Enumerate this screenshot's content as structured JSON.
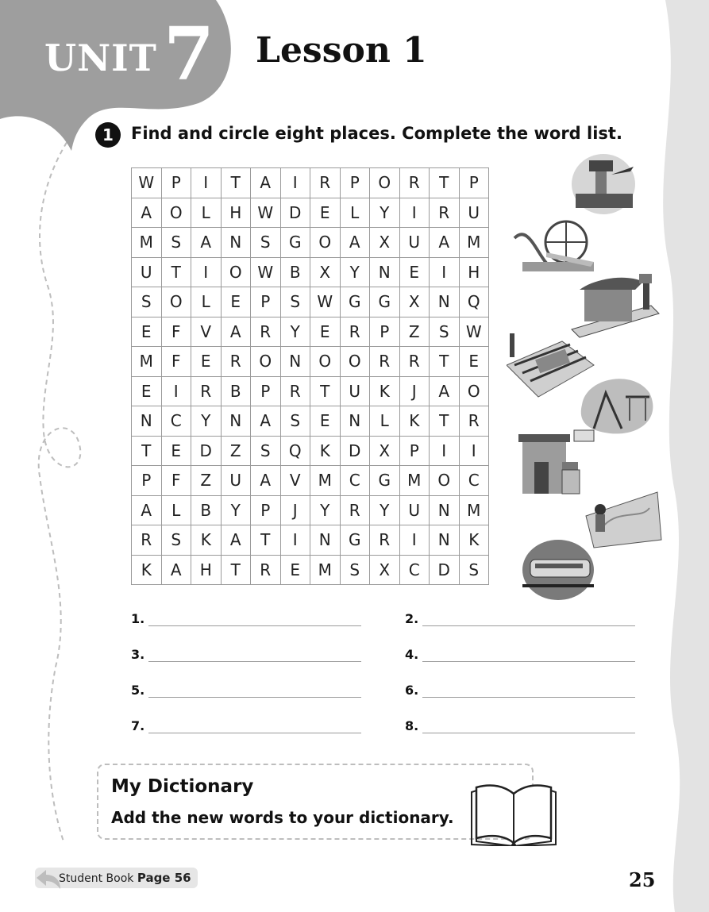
{
  "header": {
    "unit_word": "UNIT",
    "unit_number": "7",
    "lesson_title": "Lesson 1"
  },
  "activity": {
    "number": "1",
    "instructions": "Find and circle eight places. Complete the word list."
  },
  "wordsearch": {
    "rows": [
      [
        "W",
        "P",
        "I",
        "T",
        "A",
        "I",
        "R",
        "P",
        "O",
        "R",
        "T",
        "P"
      ],
      [
        "A",
        "O",
        "L",
        "H",
        "W",
        "D",
        "E",
        "L",
        "Y",
        "I",
        "R",
        "U"
      ],
      [
        "M",
        "S",
        "A",
        "N",
        "S",
        "G",
        "O",
        "A",
        "X",
        "U",
        "A",
        "M"
      ],
      [
        "U",
        "T",
        "I",
        "O",
        "W",
        "B",
        "X",
        "Y",
        "N",
        "E",
        "I",
        "H"
      ],
      [
        "S",
        "O",
        "L",
        "E",
        "P",
        "S",
        "W",
        "G",
        "G",
        "X",
        "N",
        "Q"
      ],
      [
        "E",
        "F",
        "V",
        "A",
        "R",
        "Y",
        "E",
        "R",
        "P",
        "Z",
        "S",
        "W"
      ],
      [
        "M",
        "F",
        "E",
        "R",
        "O",
        "N",
        "O",
        "O",
        "R",
        "R",
        "T",
        "E"
      ],
      [
        "E",
        "I",
        "R",
        "B",
        "P",
        "R",
        "T",
        "U",
        "K",
        "J",
        "A",
        "O"
      ],
      [
        "N",
        "C",
        "Y",
        "N",
        "A",
        "S",
        "E",
        "N",
        "L",
        "K",
        "T",
        "R"
      ],
      [
        "T",
        "E",
        "D",
        "Z",
        "S",
        "Q",
        "K",
        "D",
        "X",
        "P",
        "I",
        "I"
      ],
      [
        "P",
        "F",
        "Z",
        "U",
        "A",
        "V",
        "M",
        "C",
        "G",
        "M",
        "O",
        "C"
      ],
      [
        "A",
        "L",
        "B",
        "Y",
        "P",
        "J",
        "Y",
        "R",
        "Y",
        "U",
        "N",
        "M"
      ],
      [
        "R",
        "S",
        "K",
        "A",
        "T",
        "I",
        "N",
        "G",
        "R",
        "I",
        "N",
        "K"
      ],
      [
        "K",
        "A",
        "H",
        "T",
        "R",
        "E",
        "M",
        "S",
        "X",
        "C",
        "D",
        "S"
      ]
    ]
  },
  "pictures": [
    {
      "icon": "airport-icon"
    },
    {
      "icon": "amusement-park-icon"
    },
    {
      "icon": "bus-stop-icon"
    },
    {
      "icon": "train-track-icon"
    },
    {
      "icon": "playground-icon"
    },
    {
      "icon": "post-office-icon"
    },
    {
      "icon": "skating-rink-icon"
    },
    {
      "icon": "train-station-icon"
    }
  ],
  "word_list": [
    {
      "num": "1.",
      "value": ""
    },
    {
      "num": "2.",
      "value": ""
    },
    {
      "num": "3.",
      "value": ""
    },
    {
      "num": "4.",
      "value": ""
    },
    {
      "num": "5.",
      "value": ""
    },
    {
      "num": "6.",
      "value": ""
    },
    {
      "num": "7.",
      "value": ""
    },
    {
      "num": "8.",
      "value": ""
    }
  ],
  "dictionary": {
    "title": "My Dictionary",
    "text": "Add the new words to your dictionary."
  },
  "footer": {
    "back_ref_prefix": "Student Book",
    "back_ref_page": "Page 56",
    "page_number": "25"
  },
  "colors": {
    "tab_gray": "#9e9e9e",
    "band_gray": "#e3e3e3",
    "grid_line": "#9a9a9a"
  }
}
